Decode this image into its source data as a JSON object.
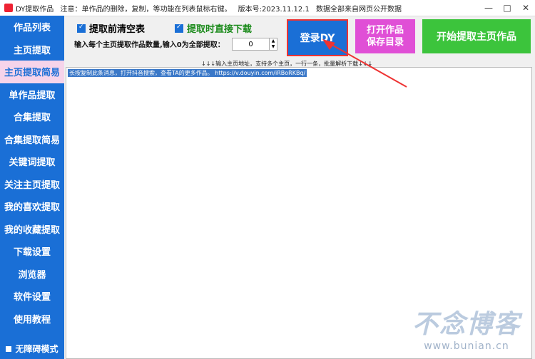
{
  "titlebar": {
    "app_name": "DY提取作品",
    "notice": "注意：单作品的删除，复制，等功能在列表鼠标右键。",
    "version": "版本号:2023.11.12.1",
    "data_note": "数据全部来自网页公开数据",
    "min": "—",
    "max": "□",
    "close": "✕"
  },
  "sidebar": {
    "items": [
      {
        "label": "作品列表"
      },
      {
        "label": "主页提取"
      },
      {
        "label": "主页提取简易"
      },
      {
        "label": "单作品提取"
      },
      {
        "label": "合集提取"
      },
      {
        "label": "合集提取简易"
      },
      {
        "label": "关键词提取"
      },
      {
        "label": "关注主页提取"
      },
      {
        "label": "我的喜欢提取"
      },
      {
        "label": "我的收藏提取"
      },
      {
        "label": "下载设置"
      },
      {
        "label": "浏览器"
      },
      {
        "label": "软件设置"
      },
      {
        "label": "使用教程"
      }
    ],
    "accessible_mode": "无障碍模式"
  },
  "options": {
    "clear_before": "提取前清空表",
    "direct_download": "提取时直接下载"
  },
  "count_input": {
    "label": "输入每个主页提取作品数量,输入0为全部提取：",
    "value": "0"
  },
  "buttons": {
    "login": "登录DY",
    "open_folder_line1": "打开作品",
    "open_folder_line2": "保存目录",
    "start": "开始提取主页作品"
  },
  "hint": "↓↓↓输入主页地址，支持多个主页，一行一条，批量解析下载↓↓↓",
  "textarea_content": "长按复制此条消息，打开抖音搜索，查看TA的更多作品。 https://v.douyin.com/iRBoRKBq/",
  "watermark": {
    "title": "不念博客",
    "url": "www.bunian.cn"
  }
}
